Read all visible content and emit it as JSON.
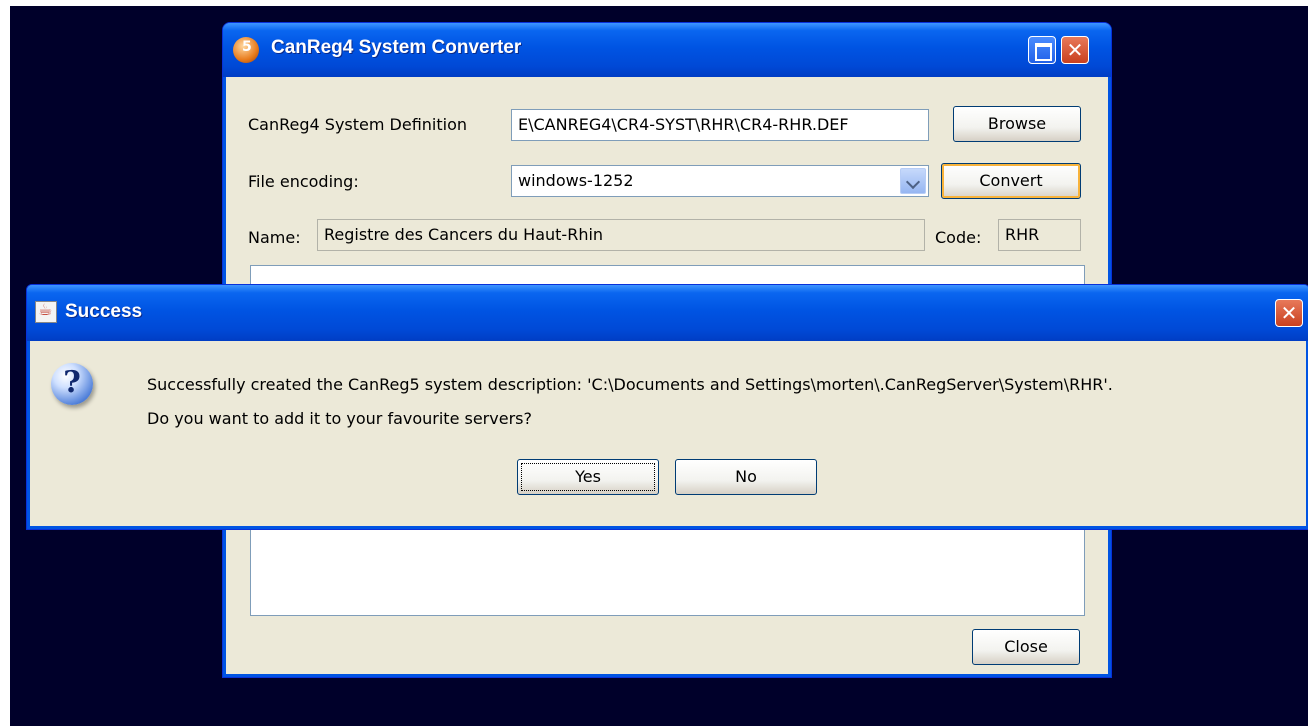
{
  "main_window": {
    "title": "CanReg4 System Converter",
    "system_definition_label": "CanReg4 System Definition",
    "system_definition_value": "E\\CANREG4\\CR4-SYST\\RHR\\CR4-RHR.DEF",
    "browse_label": "Browse",
    "file_encoding_label": "File encoding:",
    "file_encoding_value": "windows-1252",
    "convert_label": "Convert",
    "name_label": "Name:",
    "name_value": "Registre des Cancers du Haut-Rhin",
    "code_label": "Code:",
    "code_value": "RHR",
    "close_label": "Close"
  },
  "dialog": {
    "title": "Success",
    "message_line1": "Successfully created the CanReg5 system description: 'C:\\Documents and Settings\\morten\\.CanRegServer\\System\\RHR'.",
    "message_line2": "Do you want to add it to your favourite servers?",
    "yes_label": "Yes",
    "no_label": "No",
    "icon": "question-icon"
  },
  "icons": {
    "app": "canreg-app-icon",
    "dialog": "java-icon",
    "maximize": "maximize-icon",
    "close": "close-icon"
  },
  "colors": {
    "desktop": "#00002a",
    "titlebar": "#0054e3",
    "window_bg": "#ece9d8",
    "close_button": "#c9401f"
  }
}
